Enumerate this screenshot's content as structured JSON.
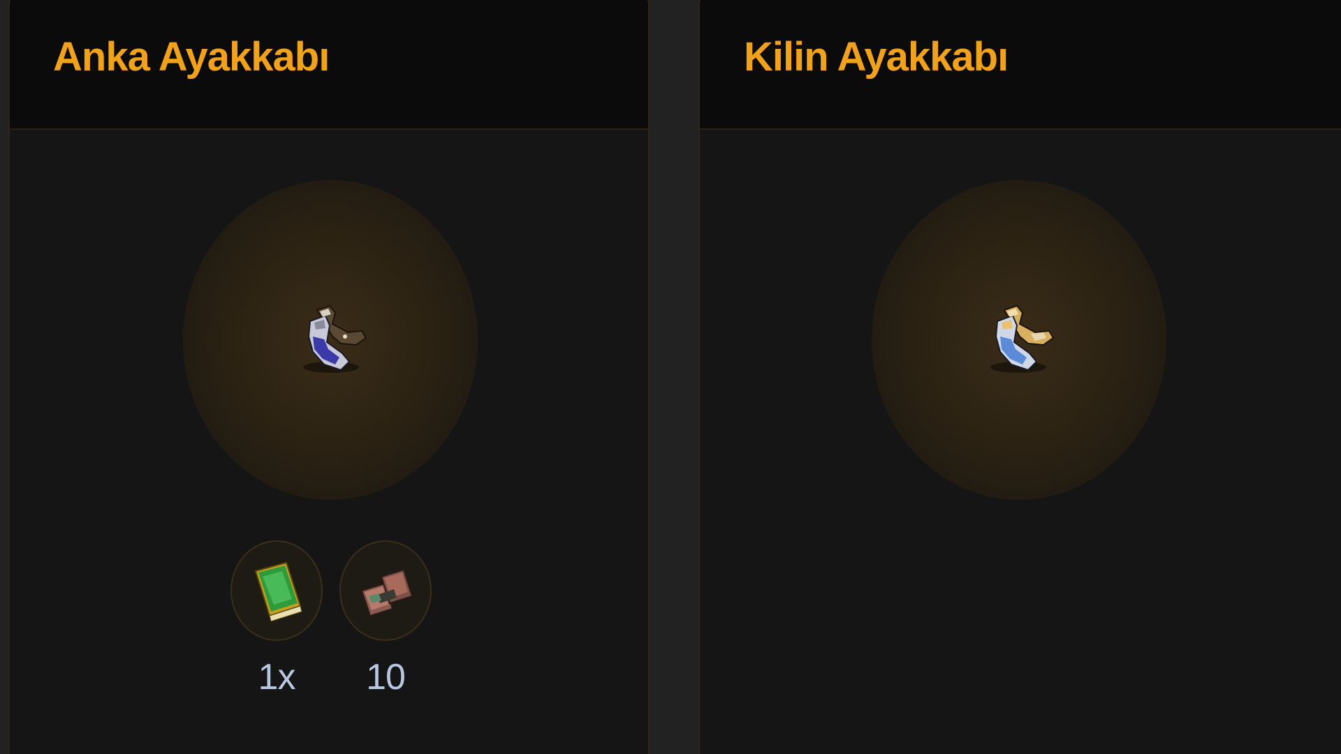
{
  "cards": [
    {
      "title": "Anka Ayakkabı",
      "item_icon": "boots-icon",
      "materials": [
        {
          "icon": "green-book-icon",
          "count": "1x"
        },
        {
          "icon": "red-scroll-stack-icon",
          "count": "10"
        }
      ]
    },
    {
      "title": "Kilin Ayakkabı",
      "item_icon": "boots-icon",
      "materials": []
    }
  ],
  "colors": {
    "title": "#f2a21a",
    "count": "#b9c8e2",
    "card_bg": "#151515",
    "header_bg": "#0b0b0b"
  }
}
